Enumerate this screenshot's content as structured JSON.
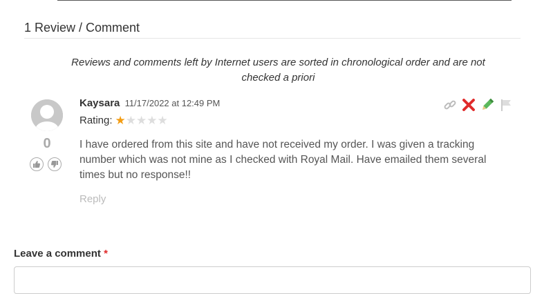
{
  "reviews": {
    "heading": "1 Review / Comment",
    "disclaimer": "Reviews and comments left by Internet users are sorted in chronological order and are not checked a priori"
  },
  "comment": {
    "author": "Kaysara",
    "date": "11/17/2022 at 12:49 PM",
    "rating_label": "Rating:",
    "rating": 1,
    "rating_max": 5,
    "text": "I have ordered from this site and have not received my order. I was given a tracking number which was not mine as I checked with Royal Mail. Have emailed them several times but no response!!",
    "reply_label": "Reply",
    "votes": "0",
    "actions": [
      "link-icon",
      "delete-icon",
      "edit-icon",
      "flag-icon"
    ]
  },
  "leave_comment": {
    "heading": "Leave a comment",
    "required_marker": "*",
    "comment_value": ""
  },
  "colors": {
    "star_on": "#f39c12",
    "star_off": "#dddddd",
    "delete": "#e02b2b",
    "edit": "#5cb85c",
    "muted": "#aaaaaa"
  }
}
